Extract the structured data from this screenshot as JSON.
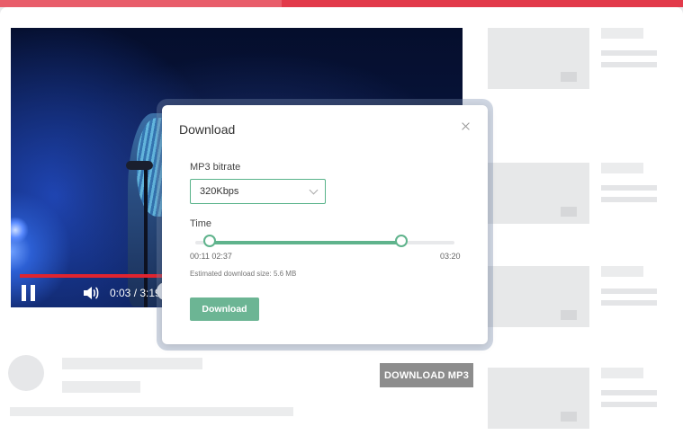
{
  "player": {
    "timecode": "0:03 / 3:19",
    "progress_fraction": 0.33,
    "icons": [
      "pause-icon",
      "volume-icon"
    ]
  },
  "download_mp3_button": "DOWNLOAD MP3",
  "modal": {
    "title": "Download",
    "bitrate_label": "MP3 bitrate",
    "bitrate_value": "320Kbps",
    "time_label": "Time",
    "range_start_fraction": 0.055,
    "range_end_fraction": 0.795,
    "start_times": "00:11 02:37",
    "end_time": "03:20",
    "estimated_size": "Estimated download size: 5.6 MB",
    "download_label": "Download"
  },
  "colors": {
    "accent_red": "#e23a4a",
    "progress_red": "#e0242f",
    "accent_green": "#5fb38c",
    "button_grey": "#8d8d8d"
  }
}
